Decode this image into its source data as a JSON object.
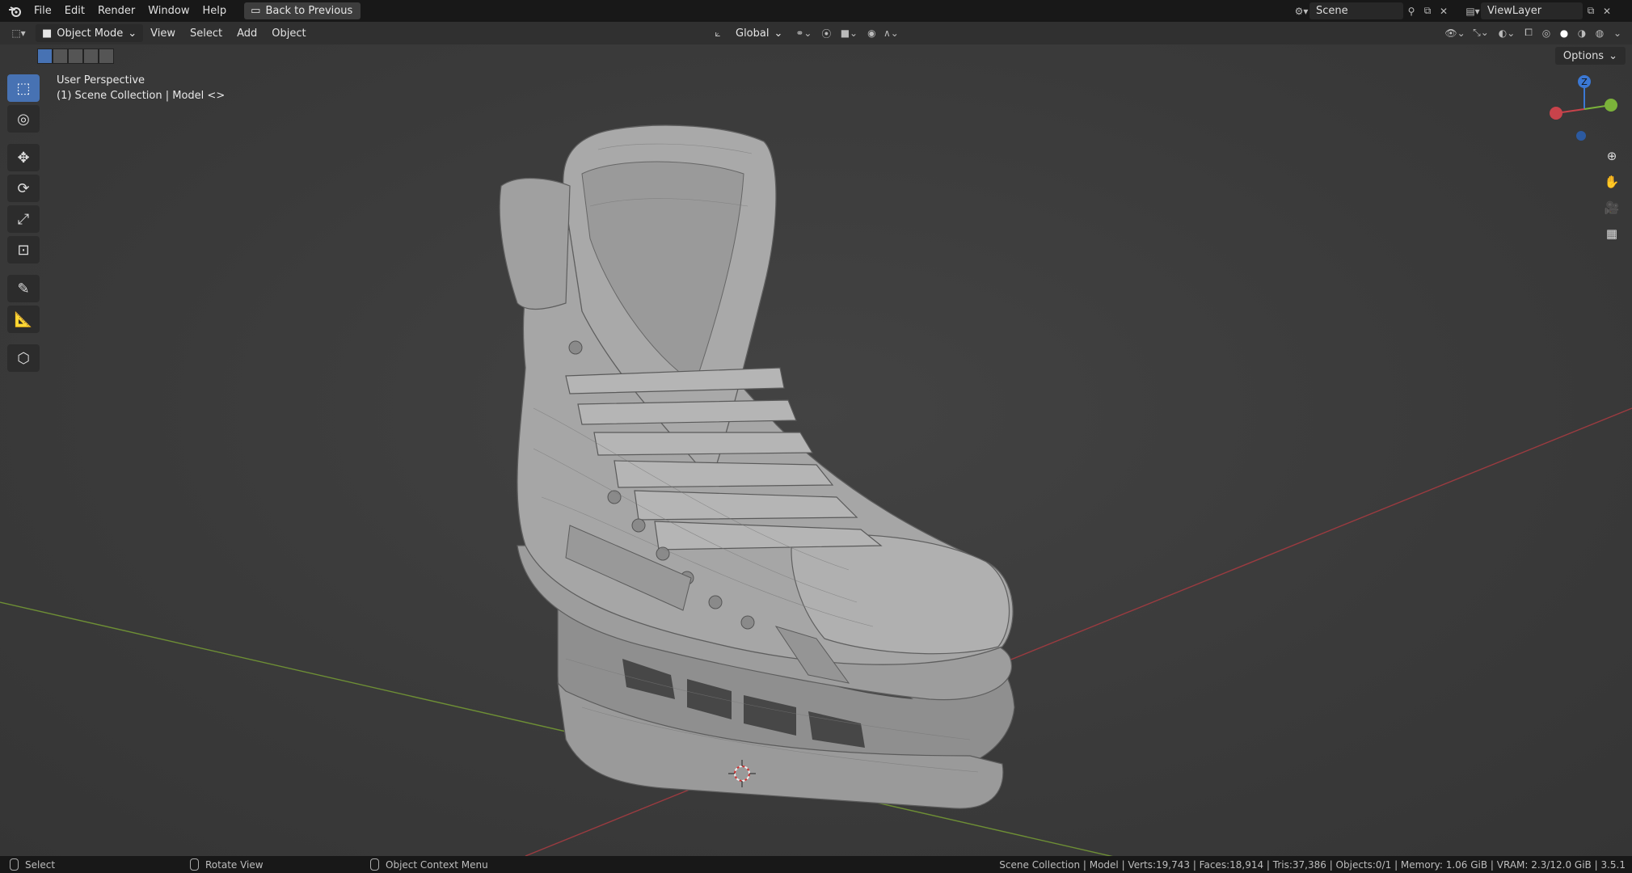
{
  "menu": {
    "file": "File",
    "edit": "Edit",
    "render": "Render",
    "window": "Window",
    "help": "Help",
    "back_to_previous": "Back to Previous"
  },
  "scene": {
    "name": "Scene"
  },
  "view_layer": {
    "name": "ViewLayer"
  },
  "header": {
    "mode": "Object Mode",
    "view": "View",
    "select": "Select",
    "add": "Add",
    "object": "Object",
    "orientation": "Global",
    "options": "Options"
  },
  "viewport": {
    "perspective": "User Perspective",
    "collection": "(1) Scene Collection | Model <>"
  },
  "gizmo": {
    "z": "Z"
  },
  "status": {
    "select": "Select",
    "rotate_view": "Rotate View",
    "context_menu": "Object Context Menu",
    "stats": "Scene Collection | Model | Verts:19,743 | Faces:18,914 | Tris:37,386 | Objects:0/1 | Memory: 1.06 GiB | VRAM: 2.3/12.0 GiB | 3.5.1"
  },
  "colors": {
    "accent": "#4772b3",
    "x_axis": "#c8434b",
    "y_axis": "#7bb23a",
    "z_axis": "#3b78d4"
  }
}
